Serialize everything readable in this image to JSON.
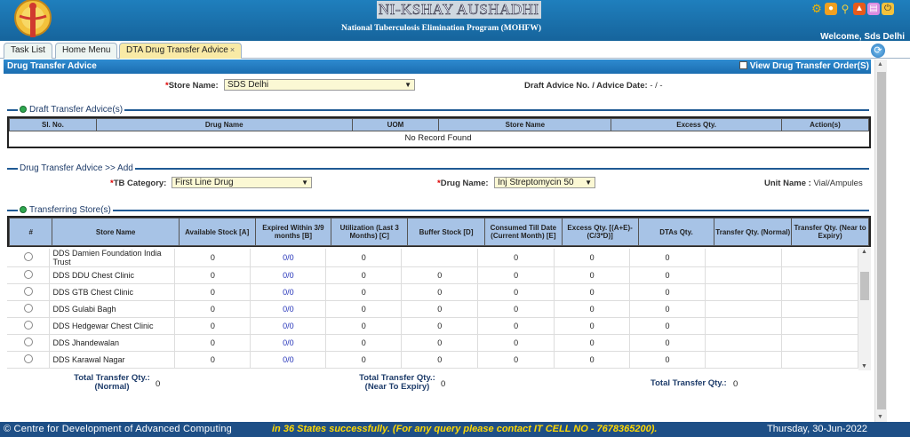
{
  "header": {
    "app_title": "NI-KSHAY AUSHADHI",
    "program": "National Tuberculosis Elimination Program (MOHFW)",
    "welcome": "Welcome, Sds Delhi"
  },
  "tabs": [
    {
      "label": "Task List"
    },
    {
      "label": "Home Menu"
    },
    {
      "label": "DTA Drug Transfer Advice",
      "close": "×"
    }
  ],
  "panel": {
    "title": "Drug Transfer Advice",
    "view_order_label": "View Drug Transfer Order(S)"
  },
  "store": {
    "label": "Store Name:",
    "value": "SDS Delhi",
    "draft_label": "Draft Advice No. / Advice Date:",
    "draft_value": "- / -"
  },
  "draft_section": {
    "legend": "Draft Transfer Advice(s)",
    "columns": [
      "Sl. No.",
      "Drug Name",
      "UOM",
      "Store Name",
      "Excess Qty.",
      "Action(s)"
    ],
    "empty_text": "No Record Found"
  },
  "add_section": {
    "legend": "Drug Transfer Advice >> Add",
    "tb_category_label": "TB Category:",
    "tb_category_value": "First Line Drug",
    "drug_name_label": "Drug Name:",
    "drug_name_value": "Inj Streptomycin 50",
    "unit_label": "Unit Name :",
    "unit_value": "Vial/Ampules"
  },
  "transfer_section": {
    "legend": "Transferring Store(s)",
    "columns": [
      "#",
      "Store Name",
      "Available Stock [A]",
      "Expired Within 3/9 months [B]",
      "Utilization (Last 3 Months) [C]",
      "Buffer Stock [D]",
      "Consumed Till Date (Current Month) [E]",
      "Excess Qty. [(A+E)-(C/3*D)]",
      "DTAs Qty.",
      "Transfer Qty. (Normal)",
      "Transfer Qty. (Near to Expiry)"
    ],
    "rows": [
      {
        "name": "DDS Damien Foundation India Trust",
        "a": "0",
        "b": "0/0",
        "c": "0",
        "d": "",
        "e": "0",
        "excess": "0",
        "dtas": "0"
      },
      {
        "name": "DDS DDU Chest Clinic",
        "a": "0",
        "b": "0/0",
        "c": "0",
        "d": "0",
        "e": "0",
        "excess": "0",
        "dtas": "0"
      },
      {
        "name": "DDS GTB Chest Clinic",
        "a": "0",
        "b": "0/0",
        "c": "0",
        "d": "0",
        "e": "0",
        "excess": "0",
        "dtas": "0"
      },
      {
        "name": "DDS Gulabi Bagh",
        "a": "0",
        "b": "0/0",
        "c": "0",
        "d": "0",
        "e": "0",
        "excess": "0",
        "dtas": "0"
      },
      {
        "name": "DDS Hedgewar Chest Clinic",
        "a": "0",
        "b": "0/0",
        "c": "0",
        "d": "0",
        "e": "0",
        "excess": "0",
        "dtas": "0"
      },
      {
        "name": "DDS Jhandewalan",
        "a": "0",
        "b": "0/0",
        "c": "0",
        "d": "0",
        "e": "0",
        "excess": "0",
        "dtas": "0"
      },
      {
        "name": "DDS Karawal Nagar",
        "a": "0",
        "b": "0/0",
        "c": "0",
        "d": "0",
        "e": "0",
        "excess": "0",
        "dtas": "0"
      }
    ],
    "total_normal_label": "Total Transfer Qty.: (Normal)",
    "total_normal_value": "0",
    "total_expiry_label": "Total Transfer Qty.: (Near To Expiry)",
    "total_expiry_value": "0",
    "total_label": "Total Transfer Qty.:",
    "total_value": "0"
  },
  "footer": {
    "left": "© Centre for Development of Advanced Computing",
    "marquee": "in 36 States successfully. (For any query please contact IT CELL NO - 7678365200).",
    "date": "Thursday, 30-Jun-2022"
  },
  "colors": {
    "header_blue": "#1f7fbd",
    "footer_blue": "#1e4f86",
    "active_tab": "#f9eaa6",
    "marquee_yellow": "#ffd800"
  }
}
